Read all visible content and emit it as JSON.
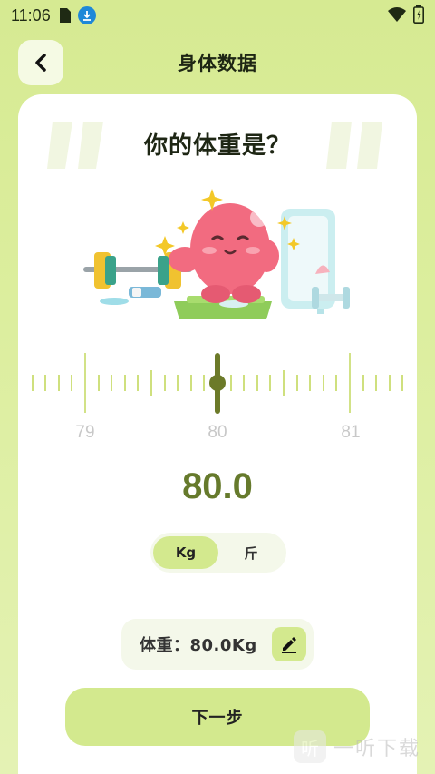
{
  "status_bar": {
    "time": "11:06",
    "icons": [
      "sim-card-icon",
      "download-icon",
      "wifi-icon",
      "battery-icon"
    ]
  },
  "header": {
    "back_icon": "chevron-left-icon",
    "title": "身体数据"
  },
  "question": "你的体重是？",
  "ruler": {
    "labels": [
      "79",
      "80",
      "81"
    ],
    "selected": 80.0
  },
  "value_display": "80.0",
  "unit_toggle": {
    "options": [
      "Kg",
      "斤"
    ],
    "selected": "Kg"
  },
  "summary": {
    "text": "体重：80.0Kg",
    "edit_icon": "pencil-icon"
  },
  "next_button": "下一步",
  "watermark": {
    "glyph": "听",
    "text": "一听下载"
  },
  "colors": {
    "accent": "#d3e98e",
    "dark_accent": "#6c7a29",
    "value_text": "#667a2c",
    "background": "#d6ea92"
  }
}
